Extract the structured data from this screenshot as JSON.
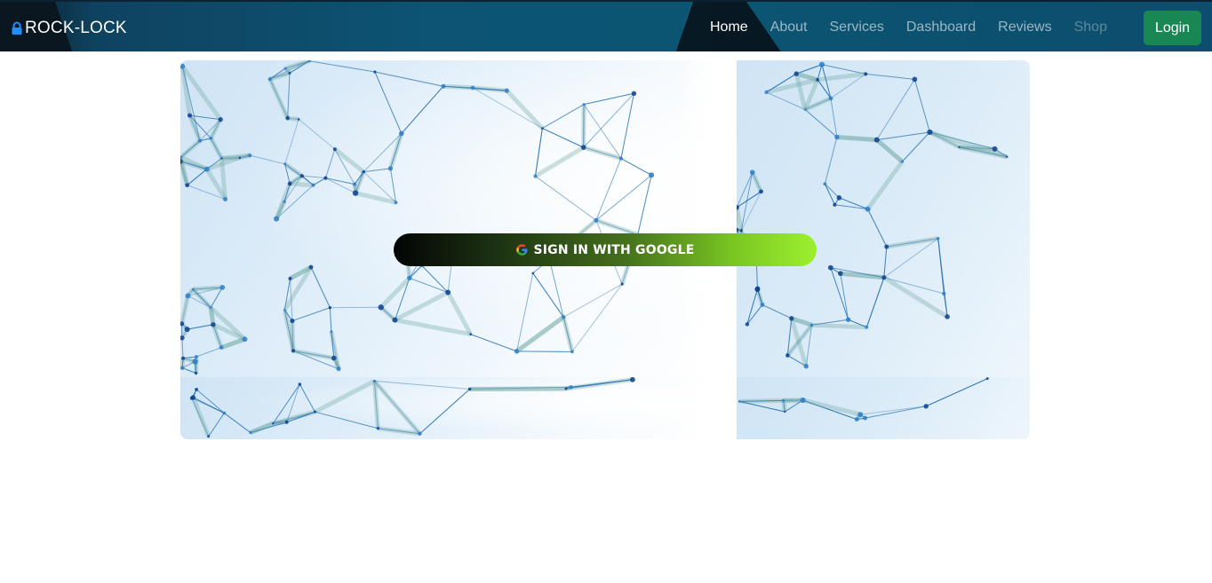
{
  "brand": {
    "name": "ROCK-LOCK",
    "icon": "lock-icon",
    "icon_color": "#1e90ff"
  },
  "nav": {
    "items": [
      {
        "label": "Home",
        "state": "active"
      },
      {
        "label": "About",
        "state": "normal"
      },
      {
        "label": "Services",
        "state": "normal"
      },
      {
        "label": "Dashboard",
        "state": "normal"
      },
      {
        "label": "Reviews",
        "state": "normal"
      },
      {
        "label": "Shop",
        "state": "disabled"
      }
    ],
    "login_label": "Login",
    "login_color": "#198754"
  },
  "hero": {
    "signin_label": "SIGN IN WITH GOOGLE",
    "signin_icon": "google-icon",
    "background": "blue polygon network"
  }
}
